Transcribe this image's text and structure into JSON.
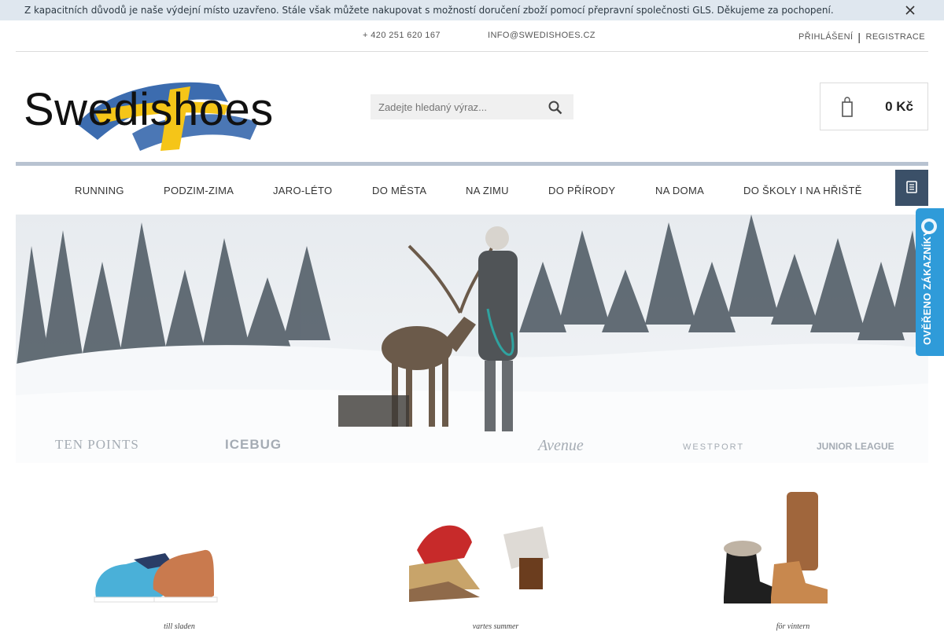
{
  "notice": {
    "text": "Z kapacitních důvodů je naše výdejní místo uzavřeno. Stále však můžete nakupovat s možností doručení zboží pomocí přepravní společnosti GLS. Děkujeme za pochopení.",
    "close_icon": "close-icon"
  },
  "topbar": {
    "left_glyph": "",
    "phone": "+ 420 251 620 167",
    "email": "INFO@SWEDISHOES.CZ",
    "login": "PŘIHLÁŠENÍ",
    "separator": "|",
    "register": "REGISTRACE",
    "phone_icon": "phone-icon",
    "email_icon": "mail-icon",
    "login_icon": "user-icon"
  },
  "header": {
    "logo_text": "Swedishoes",
    "search_placeholder": "Zadejte hledaný výraz...",
    "search_icon": "search-icon",
    "cart_total": "0 Kč",
    "cart_icon": "bag-icon"
  },
  "nav": {
    "home_glyph": "",
    "items": [
      {
        "label": "RUNNING"
      },
      {
        "label": "PODZIM-ZIMA"
      },
      {
        "label": "JARO-LÉTO"
      },
      {
        "label": "DO MĚSTA"
      },
      {
        "label": "NA ZIMU"
      },
      {
        "label": "DO PŘÍRODY"
      },
      {
        "label": "NA DOMA"
      },
      {
        "label": "DO ŠKOLY I NA HŘIŠTĚ"
      }
    ],
    "menu_icon": "menu-icon"
  },
  "hero": {
    "brands": [
      "TEN POINTS",
      "ICEBUG",
      "Avenue",
      "WESTPORT",
      "JUNIOR LEAGUE"
    ]
  },
  "trust_badge": {
    "text": "OVĚŘENO ZÁKAZNÍKY",
    "color": "#2f9bd9"
  },
  "categories": [
    {
      "caption": "till sladen"
    },
    {
      "caption": "vartes summer"
    },
    {
      "caption": "för vintern"
    }
  ],
  "colors": {
    "notice_bg": "#dfe7ef",
    "nav_accent": "#b8c3d1",
    "menu_button": "#3b5068",
    "flag_blue": "#2b5fa8",
    "flag_yellow": "#f5c518"
  }
}
